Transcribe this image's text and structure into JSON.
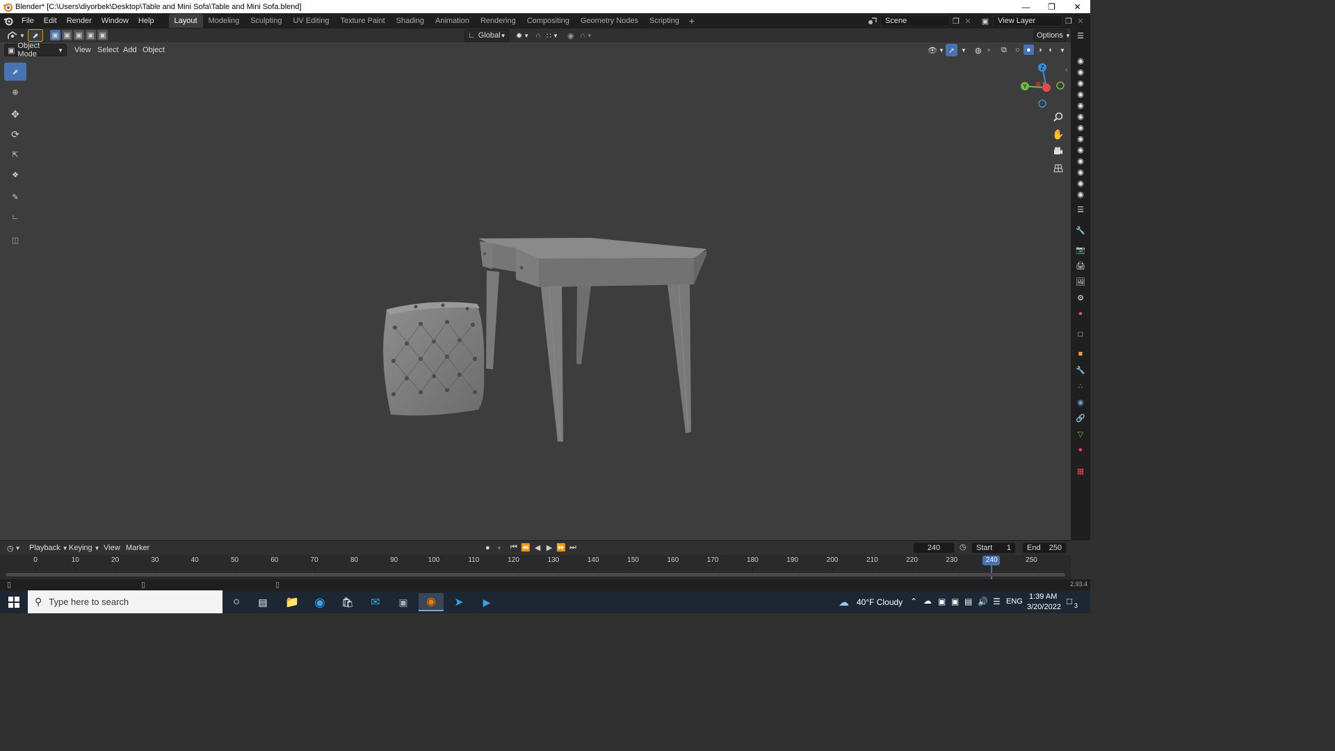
{
  "window": {
    "title": "Blender* [C:\\Users\\diyorbek\\Desktop\\Table and Mini Sofa\\Table and Mini Sofa.blend]",
    "minimize_icon": "minimize-icon",
    "restore_icon": "restore-icon",
    "close_icon": "close-icon"
  },
  "menu": {
    "items": [
      "File",
      "Edit",
      "Render",
      "Window",
      "Help"
    ]
  },
  "workspaces": {
    "tabs": [
      "Layout",
      "Modeling",
      "Sculpting",
      "UV Editing",
      "Texture Paint",
      "Shading",
      "Animation",
      "Rendering",
      "Compositing",
      "Geometry Nodes",
      "Scripting"
    ],
    "active": "Layout",
    "add_label": "+"
  },
  "scene": {
    "label": "Scene"
  },
  "view_layer": {
    "label": "View Layer"
  },
  "viewport_header": {
    "transform_orientation": "Global",
    "options_label": "Options",
    "mode": "Object Mode",
    "menus": [
      "View",
      "Select",
      "Add",
      "Object"
    ]
  },
  "timeline": {
    "menus": [
      "Playback",
      "Keying",
      "View",
      "Marker"
    ],
    "current_frame": "240",
    "start_label": "Start",
    "start_value": "1",
    "end_label": "End",
    "end_value": "250",
    "ticks": [
      "0",
      "10",
      "20",
      "30",
      "40",
      "50",
      "60",
      "70",
      "80",
      "90",
      "100",
      "110",
      "120",
      "130",
      "140",
      "150",
      "160",
      "170",
      "180",
      "190",
      "200",
      "210",
      "220",
      "230",
      "240",
      "250"
    ],
    "version": "2.93.4"
  },
  "gizmo": {
    "z": "Z",
    "y": "Y"
  },
  "taskbar": {
    "search_placeholder": "Type here to search",
    "weather": "40°F  Cloudy",
    "language": "ENG",
    "time": "1:39 AM",
    "date": "3/20/2022",
    "notifications": "3"
  },
  "colors": {
    "accent": "#4772b3",
    "viewport_bg": "#3d3d3d",
    "header_bg": "#303030",
    "topbar_bg": "#1f1f1f",
    "gizmo_x": "#e8484f",
    "gizmo_y": "#6dbe45",
    "gizmo_z": "#3b8ed9"
  }
}
